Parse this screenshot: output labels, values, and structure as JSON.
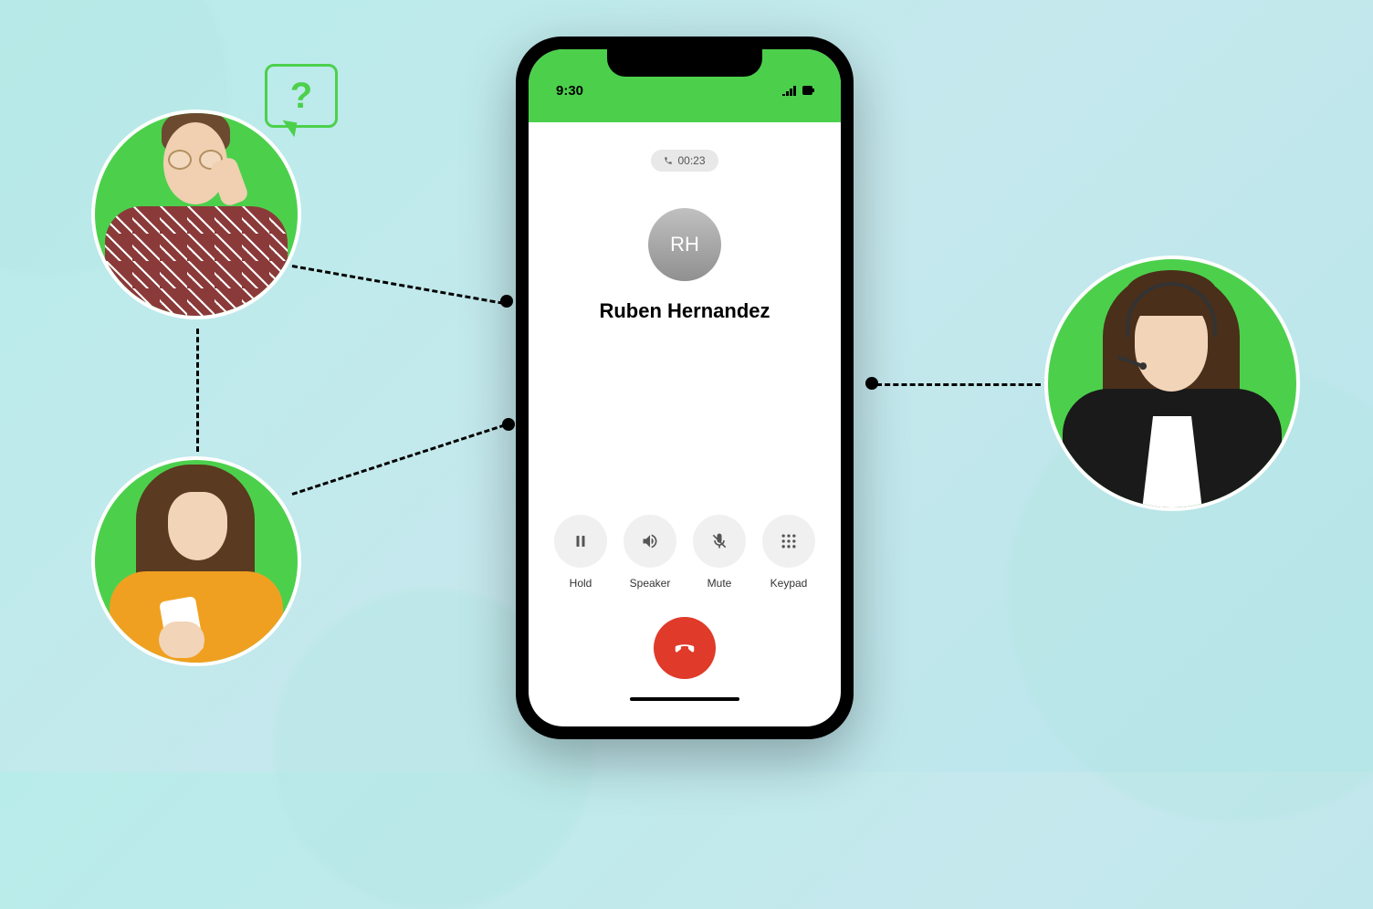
{
  "phone": {
    "status_time": "9:30",
    "call_duration": "00:23",
    "avatar_initials": "RH",
    "caller_name": "Ruben Hernandez",
    "actions": {
      "hold": "Hold",
      "speaker": "Speaker",
      "mute": "Mute",
      "keypad": "Keypad"
    }
  },
  "question_symbol": "?",
  "colors": {
    "accent_green": "#4cd04c",
    "hangup_red": "#e03a2a",
    "bg_teal": "#b8ecea"
  }
}
